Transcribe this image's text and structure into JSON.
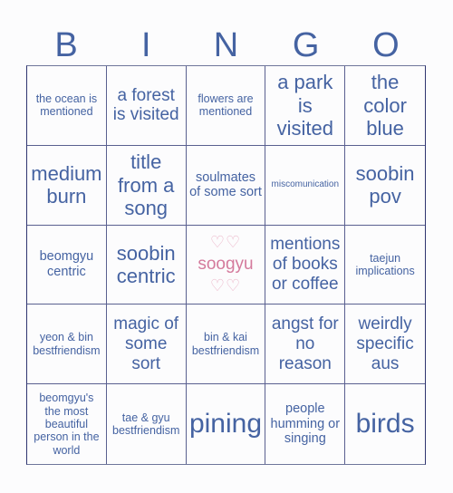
{
  "header": {
    "letters": [
      "B",
      "I",
      "N",
      "G",
      "O"
    ]
  },
  "colors": {
    "text": "#4563a2",
    "free_space": "#d47a9c",
    "hearts": "#eab3c7",
    "grid_border": "#2f3570",
    "background": "#fcfcfd"
  },
  "cells": [
    {
      "text": "the ocean is mentioned",
      "icon": null
    },
    {
      "text": "a forest is visited",
      "icon": null
    },
    {
      "text": "flowers are mentioned",
      "icon": null
    },
    {
      "text": "a park is visited",
      "icon": null
    },
    {
      "text": "the color blue",
      "icon": null
    },
    {
      "text": "medium burn",
      "icon": null
    },
    {
      "text": "title from a song",
      "icon": null
    },
    {
      "text": "soulmates of some sort",
      "icon": null
    },
    {
      "text": "miscomunication",
      "icon": null
    },
    {
      "text": "soobin pov",
      "icon": null
    },
    {
      "text": "beomgyu centric",
      "icon": null
    },
    {
      "text": "soobin centric",
      "icon": null
    },
    {
      "text": "soogyu",
      "hearts_top": "♡♡",
      "hearts_bottom": "♡♡",
      "free_space": true
    },
    {
      "text": "mentions of books or coffee",
      "icon": null
    },
    {
      "text": "taejun implications",
      "icon": null
    },
    {
      "text": "yeon & bin bestfriendism",
      "icon": null
    },
    {
      "text": "magic of some sort",
      "icon": null
    },
    {
      "text": "bin & kai bestfriendism",
      "icon": null
    },
    {
      "text": "angst for no reason",
      "icon": null
    },
    {
      "text": "weirdly specific aus",
      "icon": null
    },
    {
      "text": "beomgyu's the most beautiful person in the world",
      "icon": null
    },
    {
      "text": "tae & gyu bestfriendism",
      "icon": null
    },
    {
      "text": "pining",
      "icon": null
    },
    {
      "text": "people humming or singing",
      "icon": null
    },
    {
      "text": "birds",
      "icon": null
    }
  ]
}
